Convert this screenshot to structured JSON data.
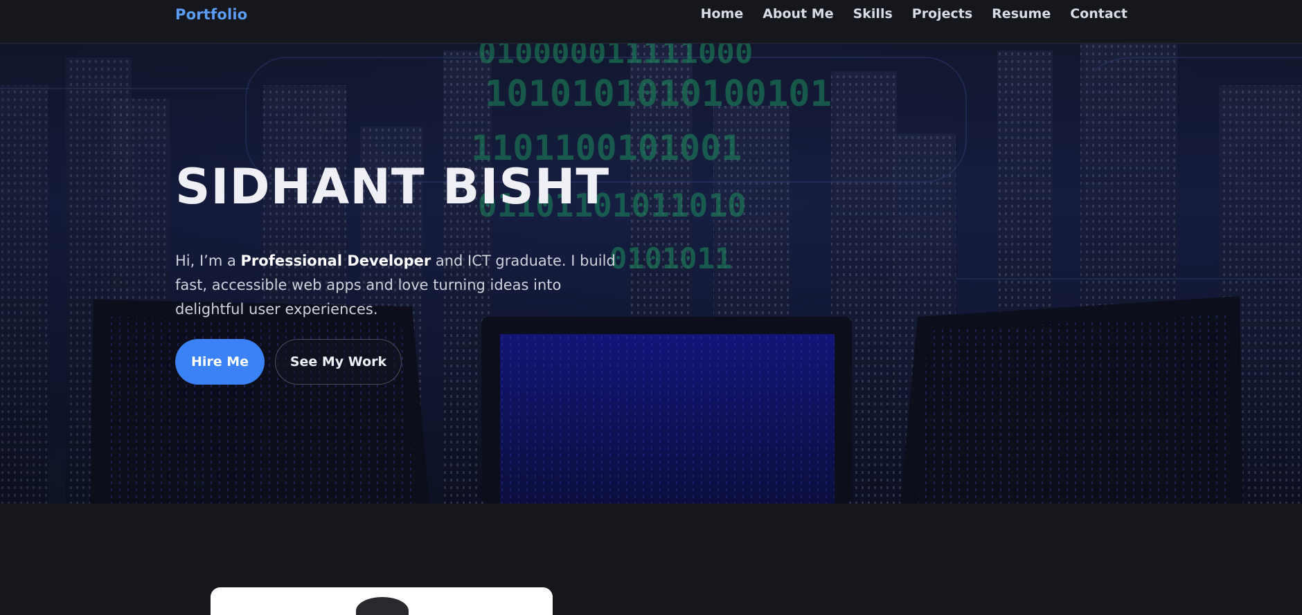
{
  "nav": {
    "brand": "Portfolio",
    "links": [
      "Home",
      "About Me",
      "Skills",
      "Projects",
      "Resume",
      "Contact"
    ]
  },
  "hero": {
    "title": "SIDHANT BISHT",
    "intro_prefix": "Hi, I’m a ",
    "intro_bold": "Professional Developer",
    "intro_suffix": " and ICT graduate. I build fast, accessible web apps and love turning ideas into delightful user experiences.",
    "background_digits": [
      "010000011111000",
      "1010101010100101",
      "1101100101001",
      "01101101011010",
      "0101011"
    ],
    "buttons": {
      "primary": "Hire Me",
      "secondary": "See My Work"
    }
  },
  "colors": {
    "accent": "#3b82f6",
    "brand": "#5b9cf5",
    "background": "#16171d"
  }
}
